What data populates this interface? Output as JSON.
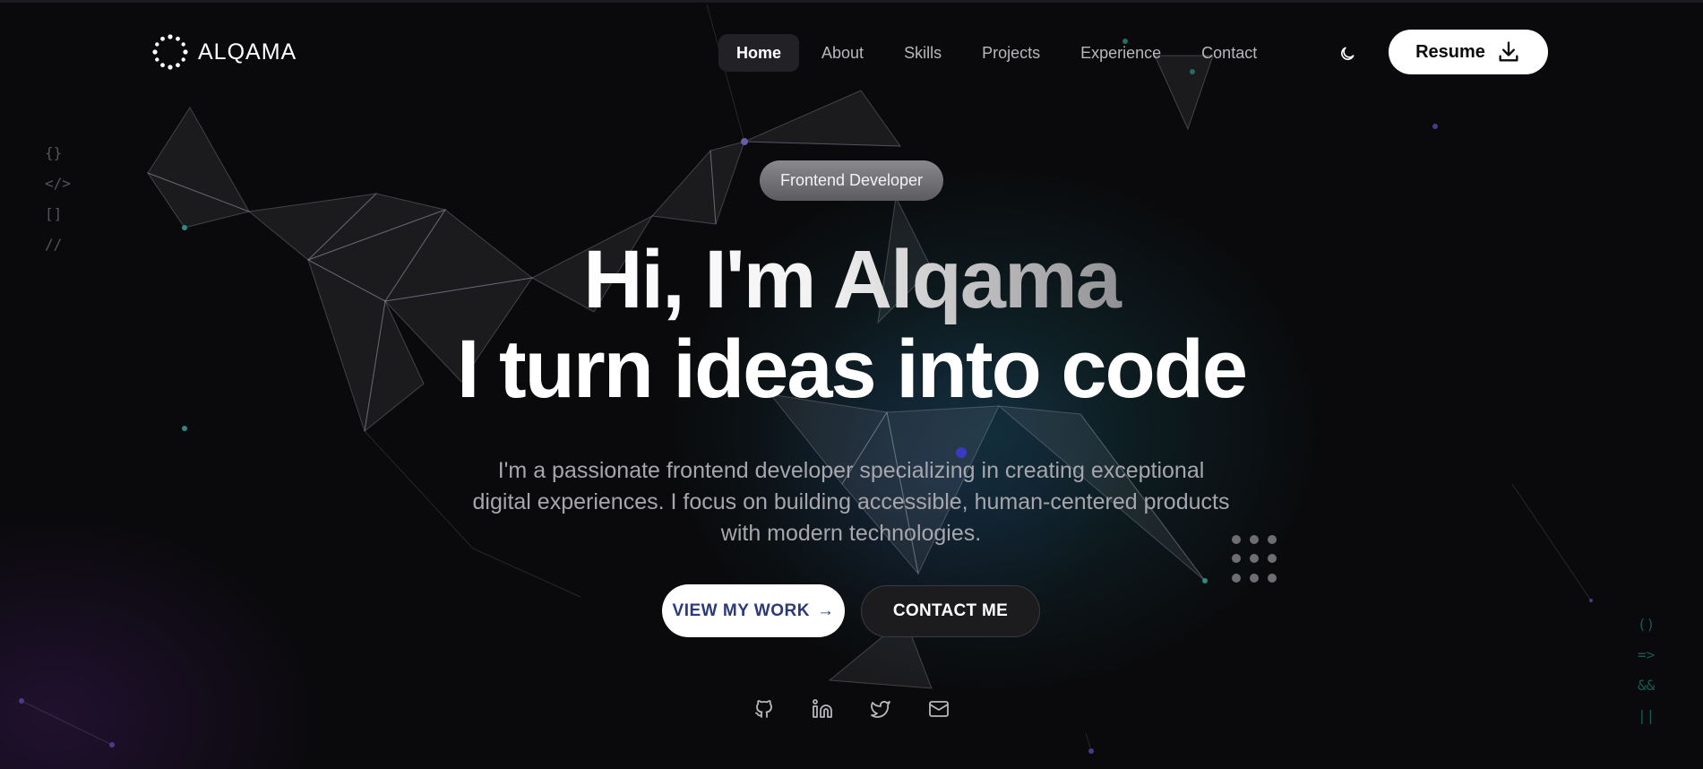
{
  "brand": {
    "name": "ALQAMA"
  },
  "nav": {
    "items": [
      {
        "label": "Home",
        "active": true
      },
      {
        "label": "About",
        "active": false
      },
      {
        "label": "Skills",
        "active": false
      },
      {
        "label": "Projects",
        "active": false
      },
      {
        "label": "Experience",
        "active": false
      },
      {
        "label": "Contact",
        "active": false
      }
    ],
    "theme_toggle_icon": "moon-icon",
    "resume": {
      "label": "Resume",
      "icon": "download-icon"
    }
  },
  "code_glyphs": {
    "left": [
      "{}",
      "</>",
      "[]",
      "//"
    ],
    "right": [
      "()",
      "=>",
      "&&",
      "||"
    ]
  },
  "hero": {
    "badge": "Frontend Developer",
    "title_line1": "Hi, I'm Alqama",
    "title_line2": "I turn ideas into code",
    "description": "I'm a passionate frontend developer specializing in creating exceptional digital experiences. I focus on building accessible, human-centered products with modern technologies.",
    "primary_cta": {
      "label": "VIEW MY WORK",
      "arrow": "→"
    },
    "secondary_cta": {
      "label": "CONTACT ME"
    }
  },
  "socials": [
    {
      "icon": "github-icon"
    },
    {
      "icon": "linkedin-icon"
    },
    {
      "icon": "twitter-icon"
    },
    {
      "icon": "mail-icon"
    }
  ],
  "colors": {
    "background": "#0a0a0c",
    "accent_teal": "#1a6a66",
    "accent_purple": "#3a1f5a",
    "primary_text_cta": "#2a3a7a"
  }
}
